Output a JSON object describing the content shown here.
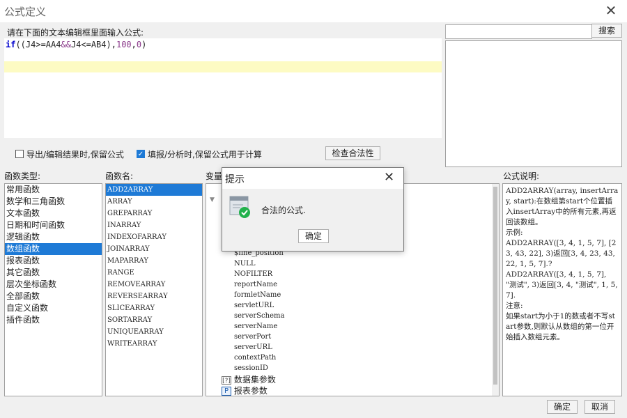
{
  "window": {
    "title": "公式定义"
  },
  "editor": {
    "prompt": "请在下面的文本编辑框里面输入公式:",
    "formula": {
      "fn": "if",
      "open": "((",
      "cond1": "J4>=AA4",
      "and": "&&",
      "cond2": "J4<=AB4",
      "close1": "),",
      "v1": "100",
      "comma": ",",
      "v2": "0",
      "close2": ")"
    }
  },
  "search": {
    "input_value": "",
    "button_label": "搜索"
  },
  "options": {
    "export_keep_label": "导出/编辑结果时,保留公式",
    "export_keep_checked": false,
    "fill_keep_label": "填报/分析时,保留公式用于计算",
    "fill_keep_checked": true,
    "check_button": "检查合法性"
  },
  "func_type": {
    "header": "函数类型:",
    "items": [
      "常用函数",
      "数学和三角函数",
      "文本函数",
      "日期和时间函数",
      "逻辑函数",
      "数组函数",
      "报表函数",
      "其它函数",
      "层次坐标函数",
      "全部函数",
      "自定义函数",
      "插件函数"
    ],
    "selected": "数组函数"
  },
  "func_name": {
    "header": "函数名:",
    "items": [
      "ADD2ARRAY",
      "ARRAY",
      "GREPARRAY",
      "INARRAY",
      "INDEXOFARRAY",
      "JOINARRAY",
      "MAPARRAY",
      "RANGE",
      "REMOVEARRAY",
      "REVERSEARRAY",
      "SLICEARRAY",
      "SORTARRAY",
      "UNIQUEARRAY",
      "WRITEARRAY"
    ],
    "selected": "ADD2ARRAY"
  },
  "variables": {
    "header": "变量",
    "items": [
      "$fine_position",
      "NULL",
      "NOFILTER",
      "reportName",
      "formletName",
      "servletURL",
      "serverSchema",
      "serverName",
      "serverPort",
      "serverURL",
      "contextPath",
      "sessionID"
    ],
    "groups": [
      {
        "icon": "dataset-icon",
        "label": "数据集参数"
      },
      {
        "icon": "report-param-icon",
        "label": "报表参数"
      }
    ]
  },
  "description": {
    "header": "公式说明:",
    "lines": [
      "ADD2ARRAY(array, insertArray, start):在数组第start个位置插",
      "入insertArray中的所有元素,再返回该数组。",
      "示例:",
      "ADD2ARRAY([3, 4, 1, 5, 7], [23, 43, 22], 3)返回[3, 4, 23, 43, 22, 1, 5, 7].?",
      "ADD2ARRAY([3, 4, 1, 5, 7], \"测试\", 3)返回[3, 4, \"测试\", 1, 5, 7].",
      "注意:",
      "如果start为小于1的数或者不写start参数,则默认从数组的第一位开始插入数组元素。"
    ]
  },
  "footer": {
    "ok": "确定",
    "cancel": "取消"
  },
  "popup": {
    "title": "提示",
    "message": "合法的公式.",
    "ok": "确定"
  },
  "colors": {
    "accent": "#1e7ad6",
    "highlight": "#fdfbc3",
    "success": "#22b14c"
  }
}
